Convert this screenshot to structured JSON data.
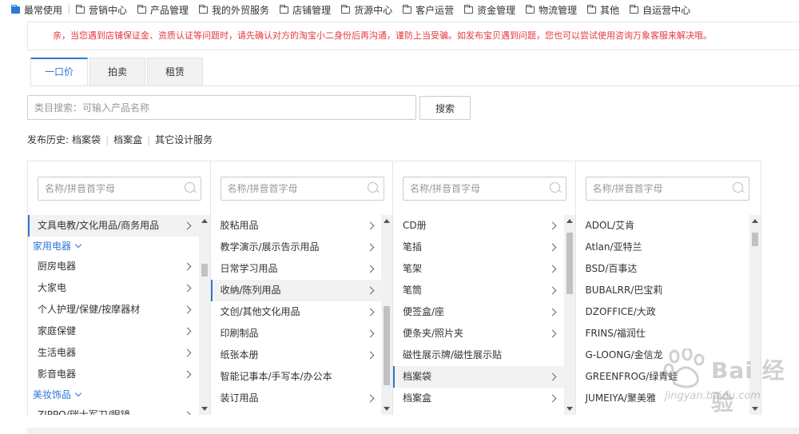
{
  "topnav": {
    "items": [
      {
        "label": "最常使用",
        "icon": "briefcase-icon"
      },
      {
        "label": "营销中心",
        "icon": "folder-icon"
      },
      {
        "label": "产品管理",
        "icon": "folder-icon"
      },
      {
        "label": "我的外贸服务",
        "icon": "folder-icon"
      },
      {
        "label": "店铺管理",
        "icon": "folder-icon"
      },
      {
        "label": "货源中心",
        "icon": "folder-icon"
      },
      {
        "label": "客户运营",
        "icon": "folder-icon"
      },
      {
        "label": "资金管理",
        "icon": "folder-icon"
      },
      {
        "label": "物流管理",
        "icon": "folder-icon"
      },
      {
        "label": "其他",
        "icon": "folder-icon"
      },
      {
        "label": "自运营中心",
        "icon": "folder-icon"
      }
    ]
  },
  "notice": "亲，当您遇到店铺保证金、资质认证等问题时，请先确认对方的淘宝小二身份后再沟通，谨防上当受骗。如发布宝贝遇到问题，您也可以尝试使用咨询万象客服来解决哦。",
  "tabs": [
    "一口价",
    "拍卖",
    "租赁"
  ],
  "search": {
    "placeholder": "类目搜索：可输入产品名称",
    "button": "搜索"
  },
  "history": {
    "label": "发布历史:",
    "items": [
      "档案袋",
      "档案盒",
      "其它设计服务"
    ]
  },
  "column_search_placeholder": "名称/拼音首字母",
  "columns": [
    {
      "rows": [
        {
          "label": "文具电教/文化用品/商务用品",
          "type": "item",
          "selected": true
        },
        {
          "label": "家用电器",
          "type": "group"
        },
        {
          "label": "厨房电器",
          "type": "item"
        },
        {
          "label": "大家电",
          "type": "item"
        },
        {
          "label": "个人护理/保健/按摩器材",
          "type": "item"
        },
        {
          "label": "家庭保健",
          "type": "item"
        },
        {
          "label": "生活电器",
          "type": "item"
        },
        {
          "label": "影音电器",
          "type": "item"
        },
        {
          "label": "美妆饰品",
          "type": "group"
        },
        {
          "label": "ZIPPO/瑞士军刀/眼镜",
          "type": "item"
        }
      ],
      "scroll": {
        "thumb_top": 0.21,
        "thumb_size": 0.07
      }
    },
    {
      "rows": [
        {
          "label": "胶粘用品",
          "type": "item"
        },
        {
          "label": "教学演示/展示告示用品",
          "type": "item"
        },
        {
          "label": "日常学习用品",
          "type": "item"
        },
        {
          "label": "收纳/陈列用品",
          "type": "item",
          "selected": true
        },
        {
          "label": "文创/其他文化用品",
          "type": "item"
        },
        {
          "label": "印刷制品",
          "type": "item"
        },
        {
          "label": "纸张本册",
          "type": "item"
        },
        {
          "label": "智能记事本/手写本/办公本",
          "type": "item",
          "nochev": true
        },
        {
          "label": "装订用品",
          "type": "item"
        }
      ],
      "scroll": {
        "thumb_top": 0.45,
        "thumb_size": 0.45
      }
    },
    {
      "rows": [
        {
          "label": "CD册",
          "type": "item"
        },
        {
          "label": "笔插",
          "type": "item"
        },
        {
          "label": "笔架",
          "type": "item"
        },
        {
          "label": "笔筒",
          "type": "item"
        },
        {
          "label": "便签盒/座",
          "type": "item"
        },
        {
          "label": "便条夹/照片夹",
          "type": "item"
        },
        {
          "label": "磁性展示牌/磁性展示贴",
          "type": "item",
          "nochev": true
        },
        {
          "label": "档案袋",
          "type": "item",
          "selected": true
        },
        {
          "label": "档案盒",
          "type": "item"
        }
      ],
      "scroll": {
        "thumb_top": 0.03,
        "thumb_size": 0.35
      }
    },
    {
      "rows": [
        {
          "label": "ADOL/艾肯",
          "type": "item",
          "nochev": true
        },
        {
          "label": "Atlan/亚特兰",
          "type": "item",
          "nochev": true
        },
        {
          "label": "BSD/百事达",
          "type": "item",
          "nochev": true
        },
        {
          "label": "BUBALRR/巴宝莉",
          "type": "item",
          "nochev": true
        },
        {
          "label": "DZOFFICE/大政",
          "type": "item",
          "nochev": true
        },
        {
          "label": "FRINS/福润仕",
          "type": "item",
          "nochev": true
        },
        {
          "label": "G-LOONG/金信龙",
          "type": "item",
          "nochev": true
        },
        {
          "label": "GREENFROG/绿青蛙",
          "type": "item",
          "nochev": true
        },
        {
          "label": "JUMEIYA/聚美雅",
          "type": "item",
          "nochev": true
        }
      ],
      "scroll": {
        "thumb_top": 0.03,
        "thumb_size": 0.08
      }
    }
  ],
  "watermark": {
    "text": "Bai 经验",
    "url": "jingyan.baidu.com"
  },
  "colors": {
    "accent": "#2b78d6",
    "notice": "#e4393c"
  }
}
